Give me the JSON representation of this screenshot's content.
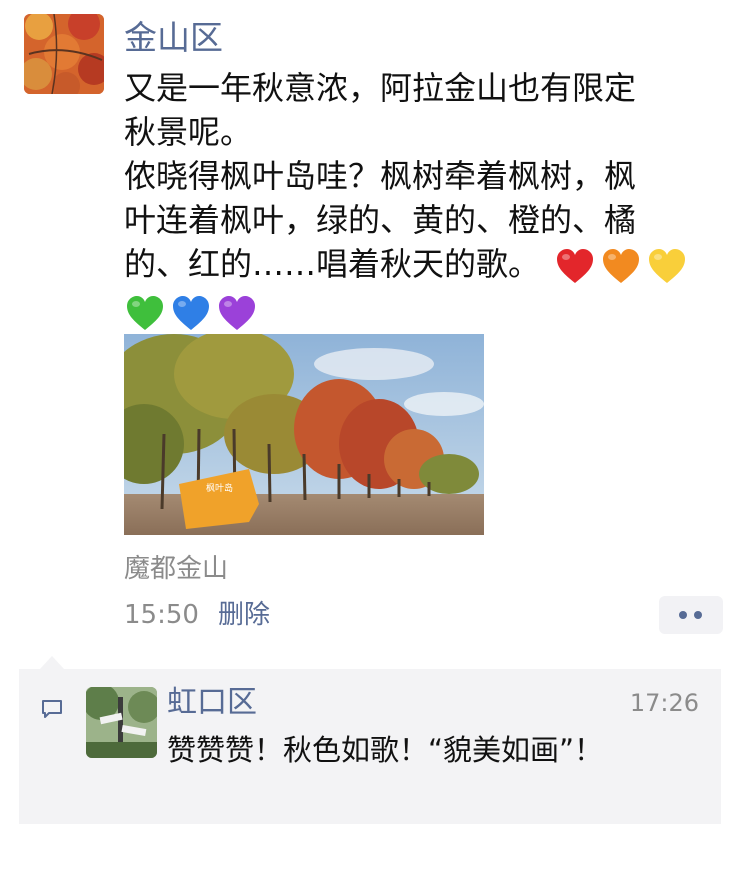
{
  "post": {
    "author": "金山区",
    "text_lines": [
      "又是一年秋意浓，阿拉金山也有限定",
      "秋景呢。",
      "侬晓得枫叶岛哇？枫树牵着枫树，枫",
      "叶连着枫叶，绿的、黄的、橙的、橘",
      "的、红的……唱着秋天的歌。"
    ],
    "emojis": [
      {
        "icon": "red-heart-icon",
        "color": "#e3262b"
      },
      {
        "icon": "orange-heart-icon",
        "color": "#f28a20"
      },
      {
        "icon": "yellow-heart-icon",
        "color": "#f9cf3a"
      },
      {
        "icon": "green-heart-icon",
        "color": "#3fbf3c"
      },
      {
        "icon": "blue-heart-icon",
        "color": "#2f7fe6"
      },
      {
        "icon": "purple-heart-icon",
        "color": "#9b41d9"
      }
    ],
    "photo_sign_text": "枫叶岛",
    "location": "魔都金山",
    "time": "15:50",
    "delete_label": "删除",
    "more_icon": "more-dots-icon"
  },
  "comment": {
    "icon": "comment-bubble-icon",
    "author": "虹口区",
    "time": "17:26",
    "text": "赞赞赞！秋色如歌！“貌美如画”！"
  },
  "colors": {
    "link_blue": "#576b95",
    "gray_text": "#8b8b8b",
    "comment_bg": "#f3f3f5"
  }
}
